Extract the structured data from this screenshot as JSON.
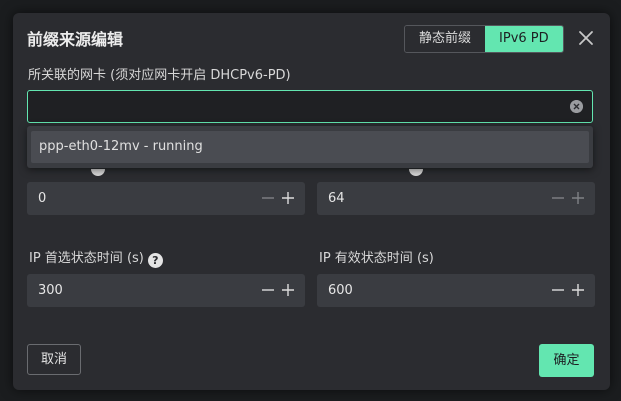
{
  "dialog": {
    "title": "前缀来源编辑",
    "tabs": [
      {
        "label": "静态前缀",
        "active": false
      },
      {
        "label": "IPv6 PD",
        "active": true
      }
    ]
  },
  "fields": {
    "interface_label": "所关联的网卡 (须对应网卡开启 DHCPv6-PD)",
    "interface_value": "",
    "dropdown_options": [
      "ppp-eth0-12mv - running"
    ],
    "field_a_value": "0",
    "field_b_value": "64",
    "preferred_label": "IP 首选状态时间 (s)",
    "preferred_value": "300",
    "valid_label": "IP 有效状态时间 (s)",
    "valid_value": "600",
    "help_glyph": "?"
  },
  "footer": {
    "cancel_label": "取消",
    "ok_label": "确定"
  },
  "colors": {
    "accent": "#63e6b0",
    "panel": "#2b2c30",
    "input_bg": "#3a3c41"
  }
}
